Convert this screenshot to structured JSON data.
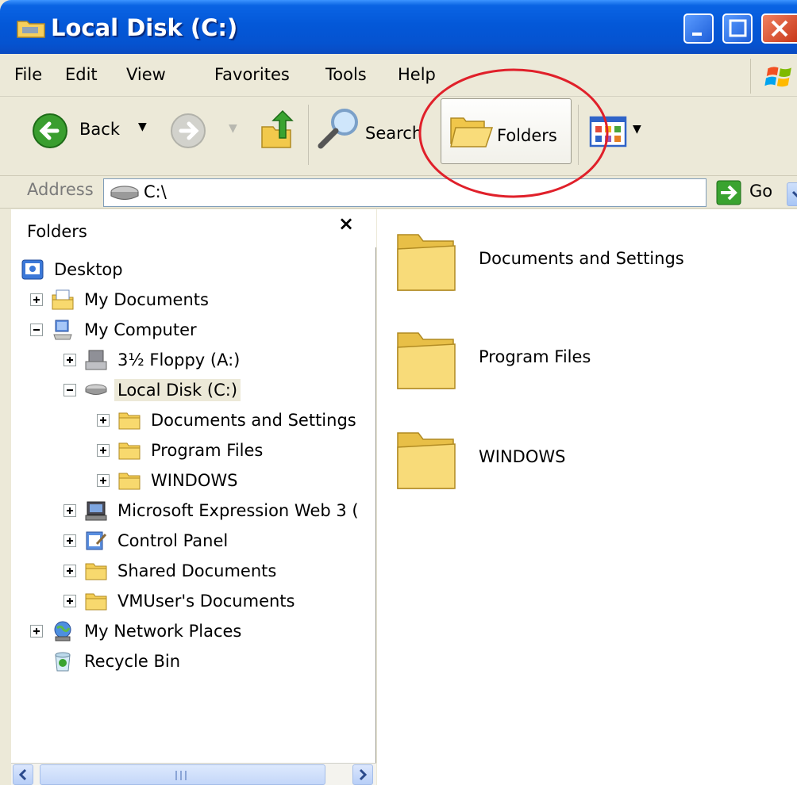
{
  "window": {
    "title": "Local Disk (C:)"
  },
  "menu": [
    "File",
    "Edit",
    "View",
    "Favorites",
    "Tools",
    "Help"
  ],
  "toolbar": {
    "back_label": "Back",
    "search_label": "Search",
    "folders_label": "Folders"
  },
  "address": {
    "label": "Address",
    "value": "C:\\",
    "go_label": "Go"
  },
  "folder_pane": {
    "title": "Folders",
    "close_glyph": "×",
    "tree": [
      {
        "label": "Desktop",
        "icon": "desktop-icon"
      },
      {
        "label": "My Documents",
        "icon": "my-documents-icon"
      },
      {
        "label": "My Computer",
        "icon": "my-computer-icon"
      },
      {
        "label": "3½ Floppy (A:)",
        "icon": "floppy-icon"
      },
      {
        "label": "Local Disk (C:)",
        "icon": "drive-icon"
      },
      {
        "label": "Documents and Settings",
        "icon": "folder-icon"
      },
      {
        "label": "Program Files",
        "icon": "folder-icon"
      },
      {
        "label": "WINDOWS",
        "icon": "folder-icon"
      },
      {
        "label": "Microsoft Expression Web 3 (",
        "icon": "app-icon"
      },
      {
        "label": "Control Panel",
        "icon": "control-panel-icon"
      },
      {
        "label": "Shared Documents",
        "icon": "folder-icon"
      },
      {
        "label": "VMUser's Documents",
        "icon": "folder-icon"
      },
      {
        "label": "My Network Places",
        "icon": "network-icon"
      },
      {
        "label": "Recycle Bin",
        "icon": "recycle-bin-icon"
      }
    ]
  },
  "content": {
    "items": [
      {
        "label": "Documents and Settings",
        "icon": "folder-icon"
      },
      {
        "label": "Program Files",
        "icon": "folder-icon"
      },
      {
        "label": "WINDOWS",
        "icon": "folder-icon"
      }
    ]
  },
  "colors": {
    "titlebar": "#0553d0",
    "chrome": "#ece9d8",
    "annotation": "#e0202a",
    "folder": "#f6d56b"
  }
}
